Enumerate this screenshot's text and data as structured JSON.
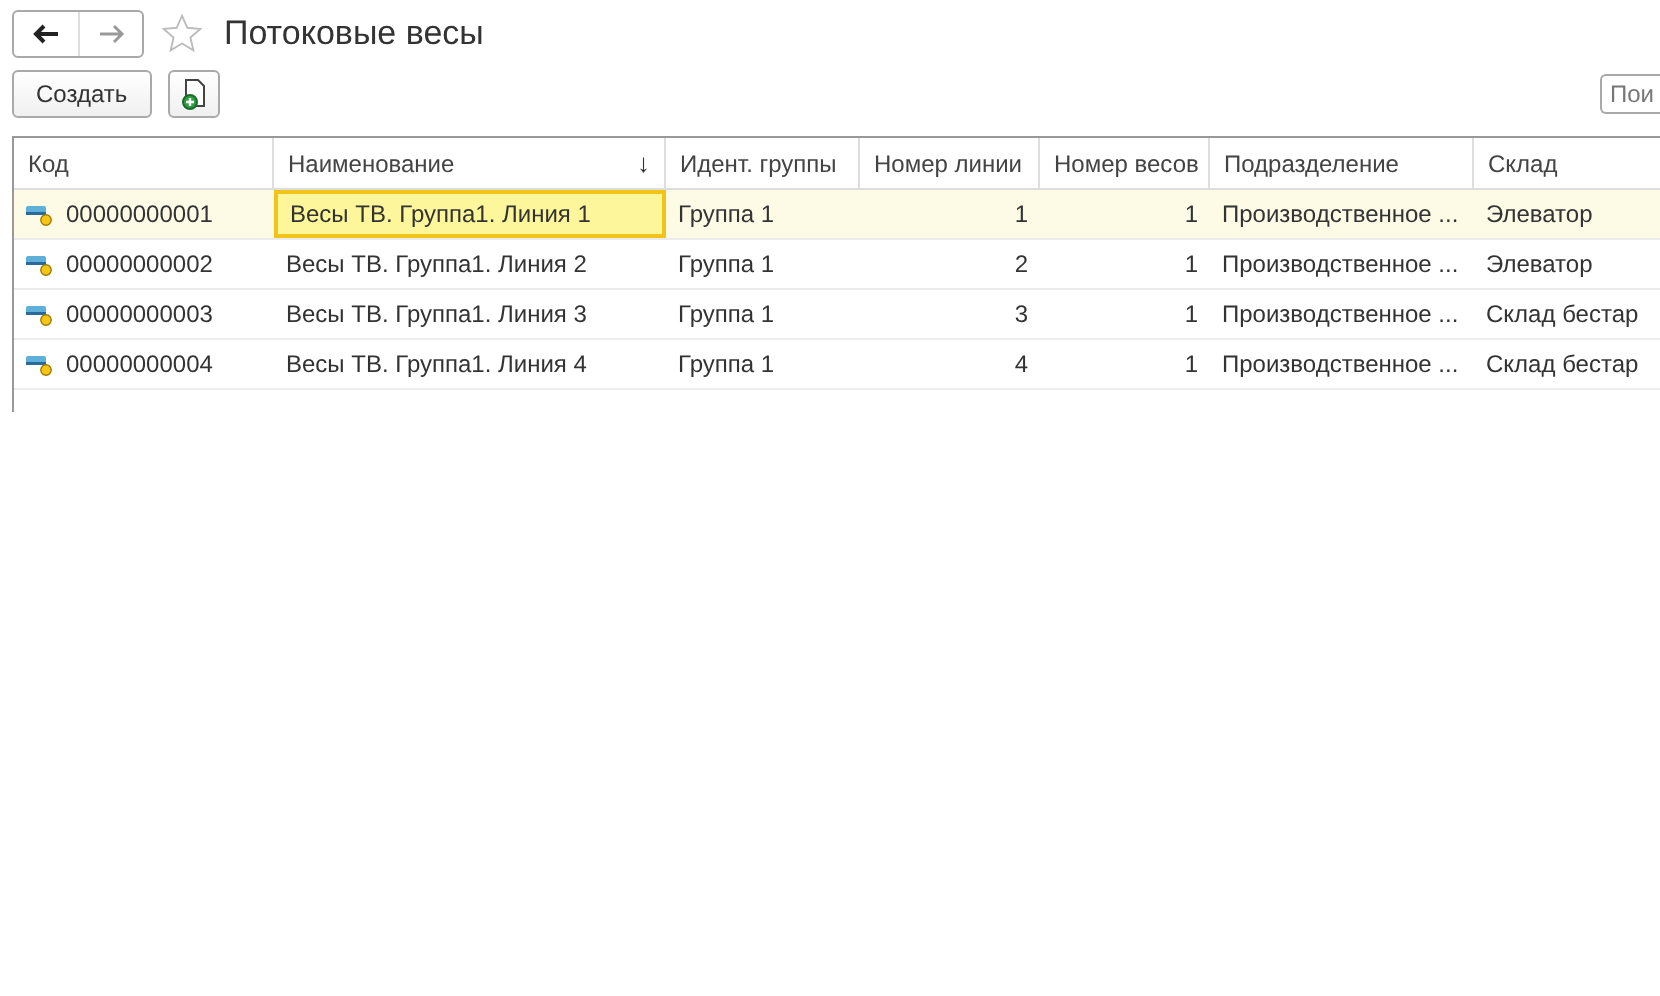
{
  "window": {
    "title": "Потоковые весы",
    "favorite": false
  },
  "toolbar": {
    "create": "Создать",
    "search": {
      "placeholder": "Пои"
    }
  },
  "table": {
    "columns": [
      {
        "label": "Код",
        "kind": "text"
      },
      {
        "label": "Наименование",
        "sort": "↓",
        "kind": "text"
      },
      {
        "label": "Идент. группы",
        "kind": "text"
      },
      {
        "label": "Номер линии",
        "kind": "number"
      },
      {
        "label": "Номер весов",
        "kind": "number"
      },
      {
        "label": "Подразделение",
        "kind": "text"
      },
      {
        "label": "Склад",
        "kind": "text"
      }
    ],
    "rows": [
      {
        "selected": true,
        "cells": [
          "00000000001",
          "Весы ТВ. Группа1. Линия 1",
          "Группа 1",
          "1",
          "1",
          "Производственное ...",
          "Элеватор"
        ]
      },
      {
        "selected": false,
        "cells": [
          "00000000002",
          "Весы ТВ. Группа1. Линия 2",
          "Группа 1",
          "2",
          "1",
          "Производственное ...",
          "Элеватор"
        ]
      },
      {
        "selected": false,
        "cells": [
          "00000000003",
          "Весы ТВ. Группа1. Линия 3",
          "Группа 1",
          "3",
          "1",
          "Производственное ...",
          "Склад бестар"
        ]
      },
      {
        "selected": false,
        "cells": [
          "00000000004",
          "Весы ТВ. Группа1. Линия 4",
          "Группа 1",
          "4",
          "1",
          "Производственное ...",
          "Склад бестар"
        ]
      }
    ]
  }
}
